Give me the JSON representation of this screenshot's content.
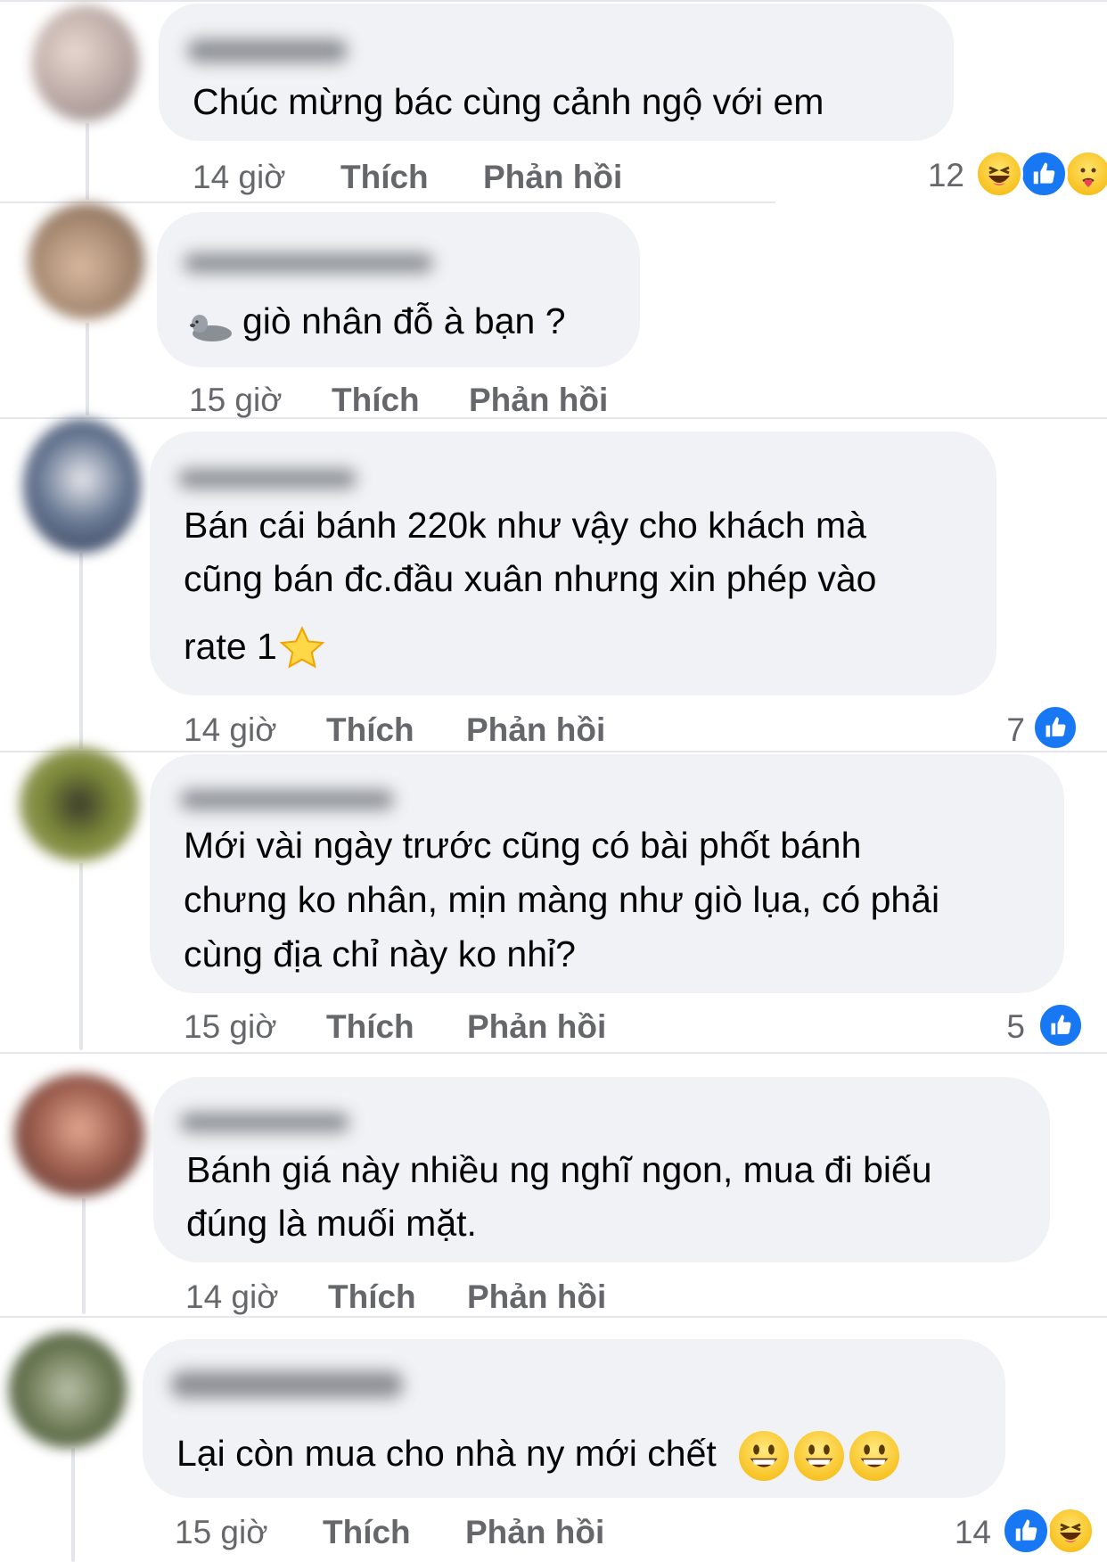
{
  "comments": [
    {
      "text_lines": [
        "Chúc mừng bác cùng cảnh ngộ với em"
      ],
      "time": "14 giờ",
      "like_label": "Thích",
      "reply_label": "Phản hồi",
      "reaction_count": "12",
      "reactions": [
        "haha-icon",
        "like-icon",
        "care-icon"
      ]
    },
    {
      "text_lines": [
        "giò nhân đỗ à bạn ?"
      ],
      "emoji": "seal-icon",
      "time": "15 giờ",
      "like_label": "Thích",
      "reply_label": "Phản hồi",
      "reaction_count": "",
      "reactions": []
    },
    {
      "text_lines": [
        "Bán cái bánh 220k như vậy cho khách mà",
        "cũng bán đc.đầu xuân nhưng xin phép vào",
        "rate 1"
      ],
      "emoji": "star-icon",
      "time": "14 giờ",
      "like_label": "Thích",
      "reply_label": "Phản hồi",
      "reaction_count": "7",
      "reactions": [
        "like-icon"
      ]
    },
    {
      "text_lines": [
        "Mới vài ngày trước cũng có bài phốt bánh",
        "chưng ko nhân, mịn màng như giò lụa, có phải",
        "cùng địa chỉ này ko nhỉ?"
      ],
      "time": "15 giờ",
      "like_label": "Thích",
      "reply_label": "Phản hồi",
      "reaction_count": "5",
      "reactions": [
        "like-icon"
      ]
    },
    {
      "text_lines": [
        "Bánh giá này nhiều ng nghĩ ngon, mua đi biếu",
        "đúng là muối mặt."
      ],
      "time": "14 giờ",
      "like_label": "Thích",
      "reply_label": "Phản hồi",
      "reaction_count": "",
      "reactions": []
    },
    {
      "text_lines": [
        "Lại còn mua cho nhà ny mới chết"
      ],
      "emoji": "smiley-icon x3",
      "time": "15 giờ",
      "like_label": "Thích",
      "reply_label": "Phản hồi",
      "reaction_count": "14",
      "reactions": [
        "like-icon",
        "haha-icon"
      ]
    }
  ],
  "colors": {
    "bubble": "#f0f2f5",
    "meta_text": "#65676b",
    "like_blue": "#1877f2",
    "text": "#050505"
  }
}
